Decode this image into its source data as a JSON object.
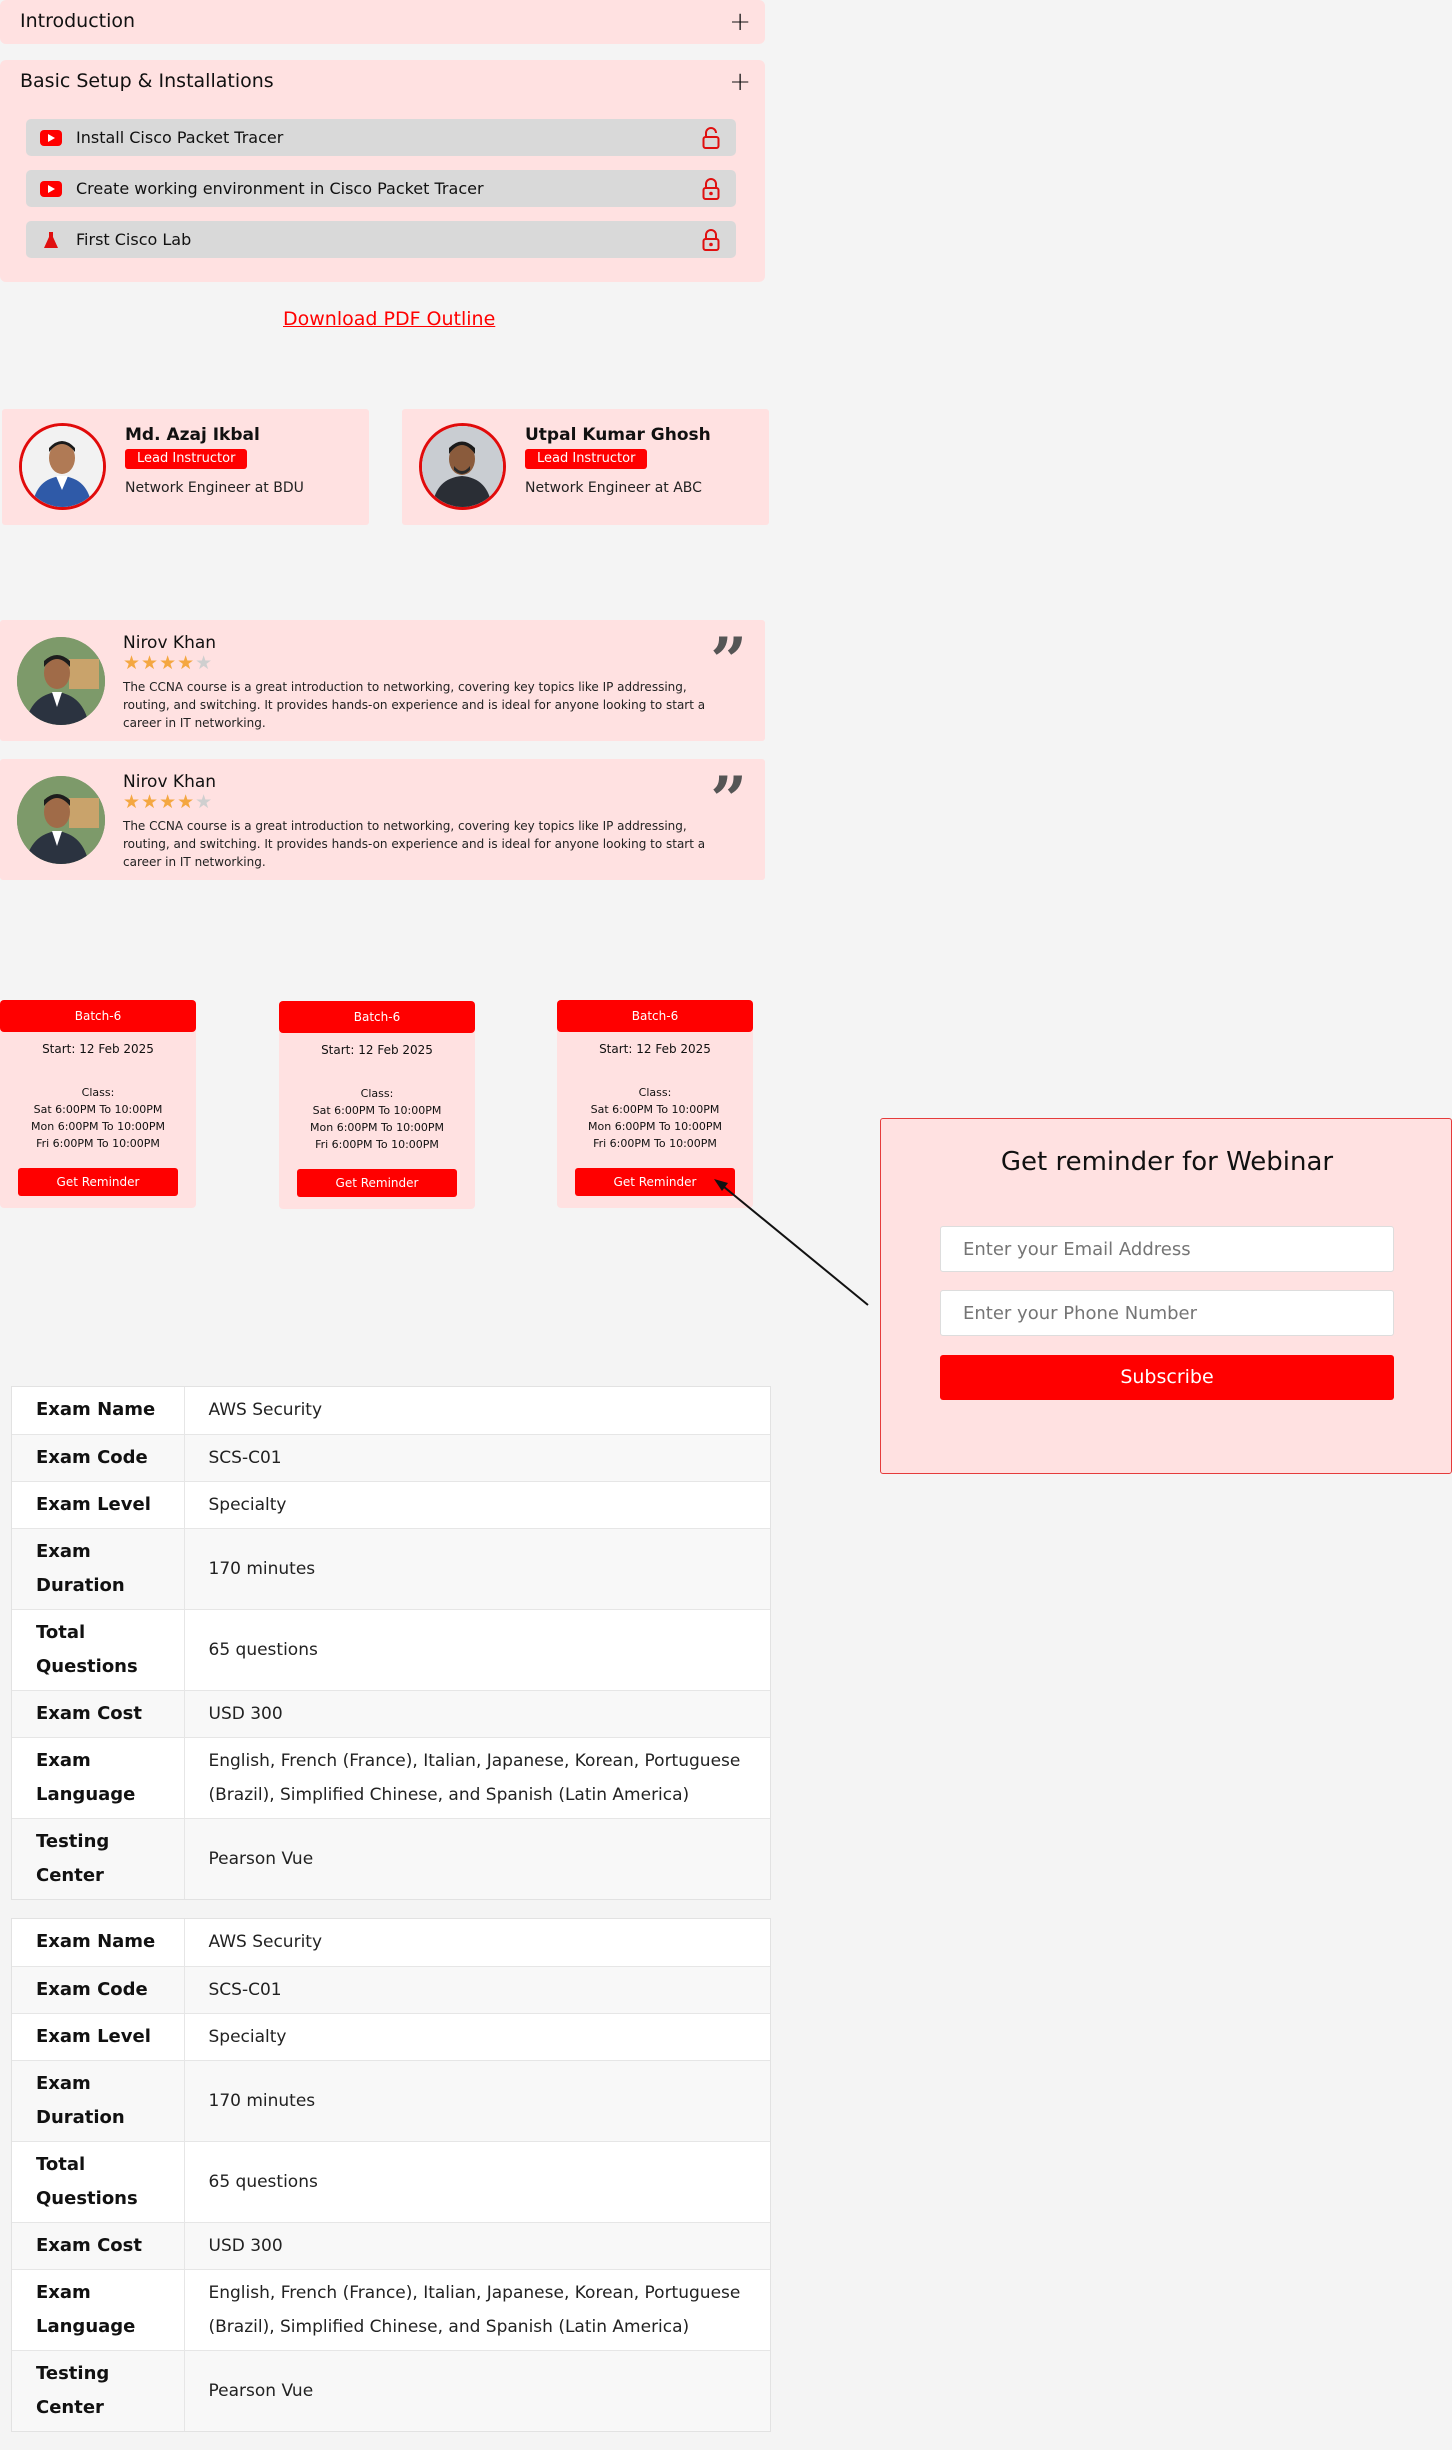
{
  "accordion": {
    "sections": [
      {
        "title": "Introduction",
        "toggle": "+"
      },
      {
        "title": "Basic Setup & Installations",
        "toggle": "+",
        "lessons": [
          {
            "label": "Install Cisco Packet Tracer",
            "icon": "youtube-icon",
            "lock": "unlocked"
          },
          {
            "label": "Create working environment in Cisco Packet Tracer",
            "icon": "youtube-icon",
            "lock": "locked"
          },
          {
            "label": "First Cisco Lab",
            "icon": "flask-icon",
            "lock": "locked"
          }
        ]
      }
    ]
  },
  "download_link": "Download PDF Outline",
  "instructors": [
    {
      "name": "Md. Azaj Ikbal",
      "badge": "Lead Instructor",
      "role": "Network Engineer at BDU"
    },
    {
      "name": "Utpal Kumar Ghosh",
      "badge": "Lead Instructor",
      "role": "Network Engineer at ABC"
    }
  ],
  "reviews": [
    {
      "name": "Nirov Khan",
      "rating": 4,
      "max_rating": 5,
      "text": "The CCNA course is a great introduction to networking, covering key topics like IP addressing, routing, and switching. It provides hands-on experience and is ideal for anyone looking to start a career in IT networking."
    },
    {
      "name": "Nirov Khan",
      "rating": 4,
      "max_rating": 5,
      "text": "The CCNA course is a great introduction to networking, covering key topics like IP addressing, routing, and switching. It provides hands-on experience and is ideal for anyone looking to start a career in IT networking."
    }
  ],
  "batches": [
    {
      "title": "Batch-6",
      "start": "Start: 12 Feb 2025",
      "class_label": "Class:",
      "schedule": [
        "Sat 6:00PM To 10:00PM",
        "Mon 6:00PM To 10:00PM",
        "Fri 6:00PM To 10:00PM"
      ],
      "button": "Get Reminder"
    },
    {
      "title": "Batch-6",
      "start": "Start: 12 Feb 2025",
      "class_label": "Class:",
      "schedule": [
        "Sat 6:00PM To 10:00PM",
        "Mon 6:00PM To 10:00PM",
        "Fri 6:00PM To 10:00PM"
      ],
      "button": "Get Reminder"
    },
    {
      "title": "Batch-6",
      "start": "Start: 12 Feb 2025",
      "class_label": "Class:",
      "schedule": [
        "Sat 6:00PM To 10:00PM",
        "Mon 6:00PM To 10:00PM",
        "Fri 6:00PM To 10:00PM"
      ],
      "button": "Get Reminder"
    }
  ],
  "webinar": {
    "title": "Get reminder for Webinar",
    "email_placeholder": "Enter your Email Address",
    "phone_placeholder": "Enter your Phone Number",
    "button": "Subscribe"
  },
  "exam_tables": [
    {
      "rows": [
        {
          "key": "Exam Name",
          "value": "AWS Security"
        },
        {
          "key": "Exam Code",
          "value": "SCS-C01"
        },
        {
          "key": "Exam Level",
          "value": "Specialty"
        },
        {
          "key": "Exam Duration",
          "value": "170 minutes"
        },
        {
          "key": "Total Questions",
          "value": "65 questions"
        },
        {
          "key": "Exam Cost",
          "value": "USD 300"
        },
        {
          "key": "Exam Language",
          "value": "English, French (France), Italian, Japanese, Korean, Portuguese (Brazil), Simplified Chinese, and Spanish (Latin America)"
        },
        {
          "key": "Testing Center",
          "value": "Pearson Vue"
        }
      ]
    },
    {
      "rows": [
        {
          "key": "Exam Name",
          "value": "AWS Security"
        },
        {
          "key": "Exam Code",
          "value": "SCS-C01"
        },
        {
          "key": "Exam Level",
          "value": "Specialty"
        },
        {
          "key": "Exam Duration",
          "value": "170 minutes"
        },
        {
          "key": "Total Questions",
          "value": "65 questions"
        },
        {
          "key": "Exam Cost",
          "value": "USD 300"
        },
        {
          "key": "Exam Language",
          "value": "English, French (France), Italian, Japanese, Korean, Portuguese (Brazil), Simplified Chinese, and Spanish (Latin America)"
        },
        {
          "key": "Testing Center",
          "value": "Pearson Vue"
        }
      ]
    }
  ],
  "colors": {
    "accent": "#ff0000",
    "card_bg": "#ffe1e1",
    "page_bg": "#f4f4f4",
    "star": "#f4a741"
  }
}
